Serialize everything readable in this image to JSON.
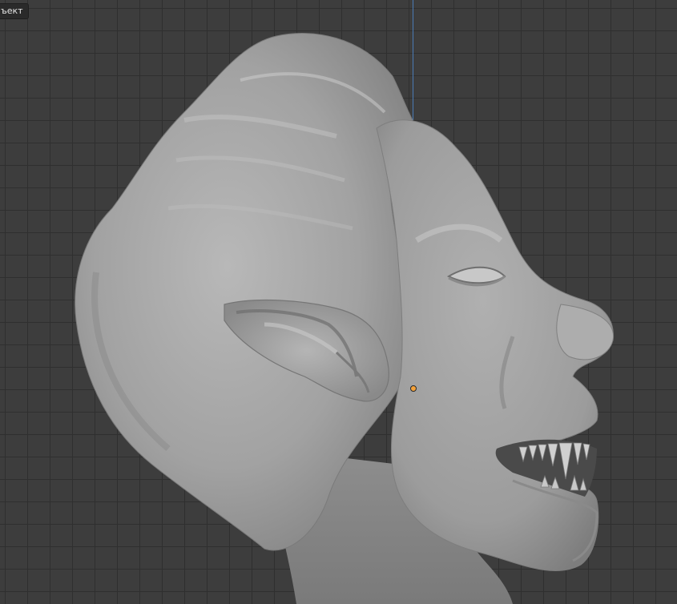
{
  "viewport": {
    "mode_label": "ъект"
  },
  "colors": {
    "background": "#3d3d3d",
    "grid_line": "#2f2f2f",
    "axis_z": "#4a7bb5",
    "origin": "#f5a23a",
    "mesh": "#9a9a9a"
  },
  "icons": {
    "origin": "object-origin-icon"
  }
}
